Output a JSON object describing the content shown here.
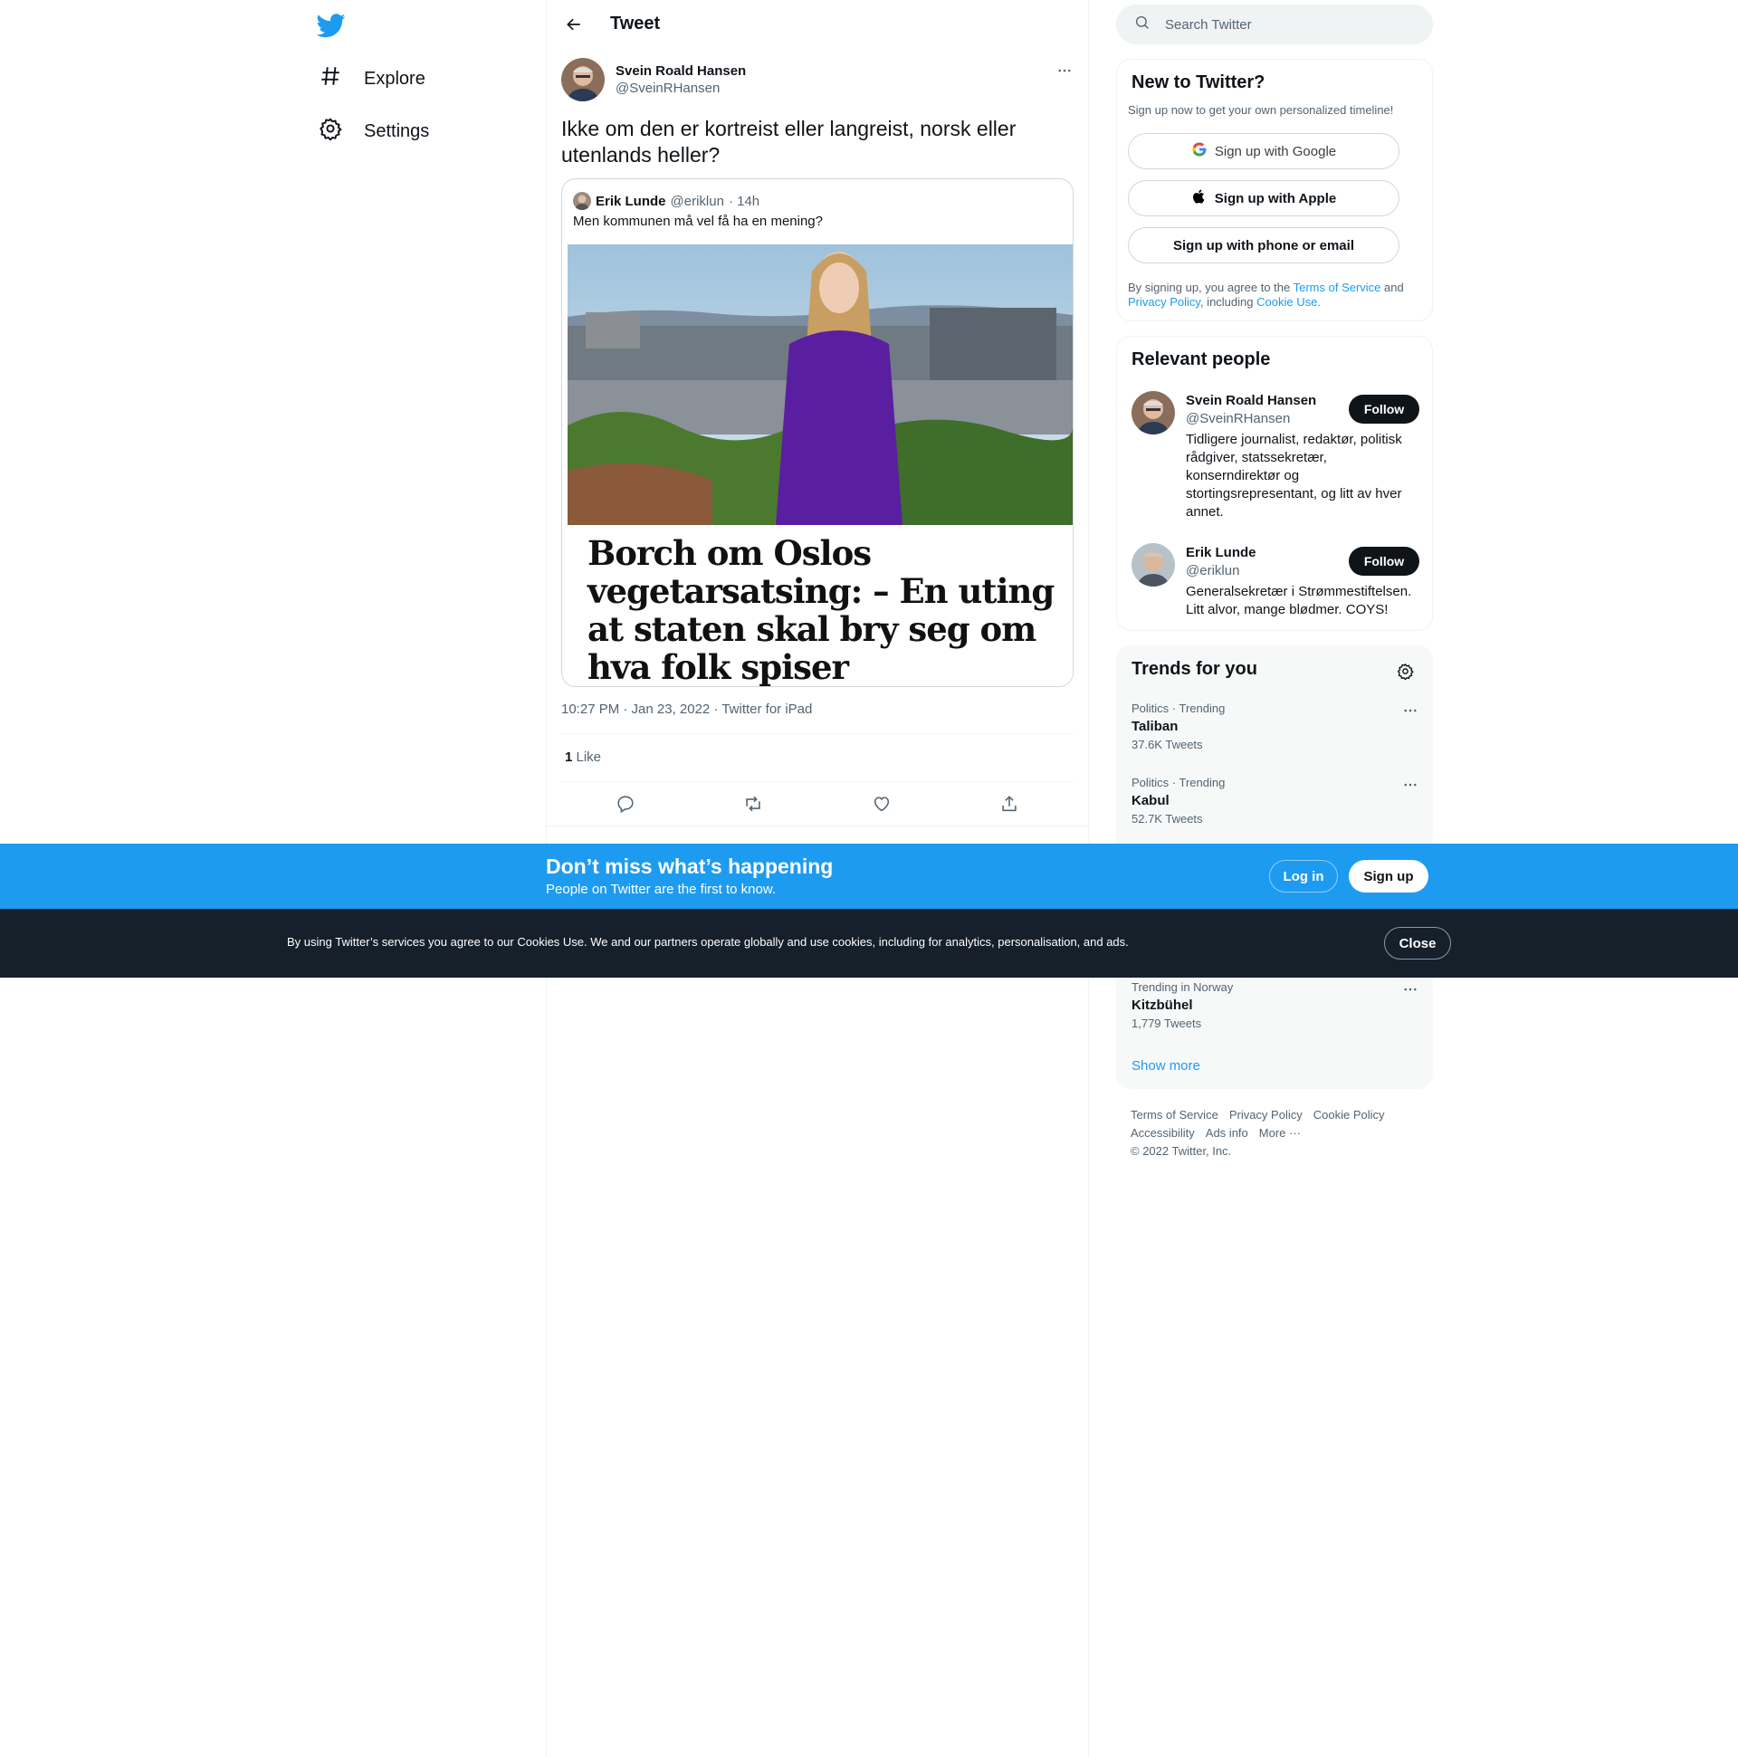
{
  "nav": {
    "items": [
      {
        "label": "Explore",
        "icon": "hashtag-icon"
      },
      {
        "label": "Settings",
        "icon": "gear-icon"
      }
    ]
  },
  "header": {
    "title": "Tweet"
  },
  "tweet": {
    "author_name": "Svein Roald Hansen",
    "author_handle": "@SveinRHansen",
    "text": "Ikke om den er kortreist eller langreist, norsk eller utenlands heller?",
    "quote": {
      "author_name": "Erik Lunde",
      "author_handle": "@eriklun",
      "time": "· 14h",
      "text": "Men kommunen må vel få ha en mening?",
      "image_headline": "Borch om Oslos vegetarsatsing: – En uting at staten skal bry seg om hva folk spiser"
    },
    "timestamp": "10:27 PM · Jan 23, 2022 · Twitter for iPad",
    "like_count": "1",
    "like_label": " Like"
  },
  "search": {
    "placeholder": "Search Twitter"
  },
  "signup_card": {
    "title": "New to Twitter?",
    "subtitle": "Sign up now to get your own personalized timeline!",
    "google": "Sign up with Google",
    "apple": "Sign up with Apple",
    "phone": "Sign up with phone or email",
    "legal_prefix": "By signing up, you agree to the ",
    "tos": "Terms of Service",
    "and": " and ",
    "privacy": "Privacy Policy",
    "including": ", including ",
    "cookie": "Cookie Use."
  },
  "relevant": {
    "title": "Relevant people",
    "people": [
      {
        "name": "Svein Roald Hansen",
        "handle": "@SveinRHansen",
        "bio": "Tidligere journalist, redaktør, politisk rådgiver, statssekretær, konserndirektør og stortingsrepresentant, og litt av hver annet.",
        "follow": "Follow"
      },
      {
        "name": "Erik Lunde",
        "handle": "@eriklun",
        "bio": "Generalsekretær i Strømmestiftelsen. Litt alvor, mange blødmer. COYS!",
        "follow": "Follow"
      }
    ]
  },
  "trends": {
    "title": "Trends for you",
    "items": [
      {
        "category": "Politics · Trending",
        "name": "Taliban",
        "count": "37.6K Tweets"
      },
      {
        "category": "Politics · Trending",
        "name": "Kabul",
        "count": "52.7K Tweets"
      },
      {
        "category": "Trending in Norway",
        "name": "Kitzbühel",
        "count": "1,779 Tweets"
      }
    ],
    "show_more": "Show more"
  },
  "footer": {
    "links": [
      "Terms of Service",
      "Privacy Policy",
      "Cookie Policy",
      "Accessibility",
      "Ads info",
      "More ···"
    ],
    "copyright": "© 2022 Twitter, Inc."
  },
  "banner": {
    "title": "Don’t miss what’s happening",
    "subtitle": "People on Twitter are the first to know.",
    "login": "Log in",
    "signup": "Sign up"
  },
  "cookie_bar": {
    "text": "By using Twitter’s services you agree to our Cookies Use. We and our partners operate globally and use cookies, including for analytics, personalisation, and ads.",
    "close": "Close"
  },
  "colors": {
    "accent": "#1d9bf0",
    "text": "#0f1419",
    "muted": "#536471",
    "cookie_bg": "#15202b"
  }
}
